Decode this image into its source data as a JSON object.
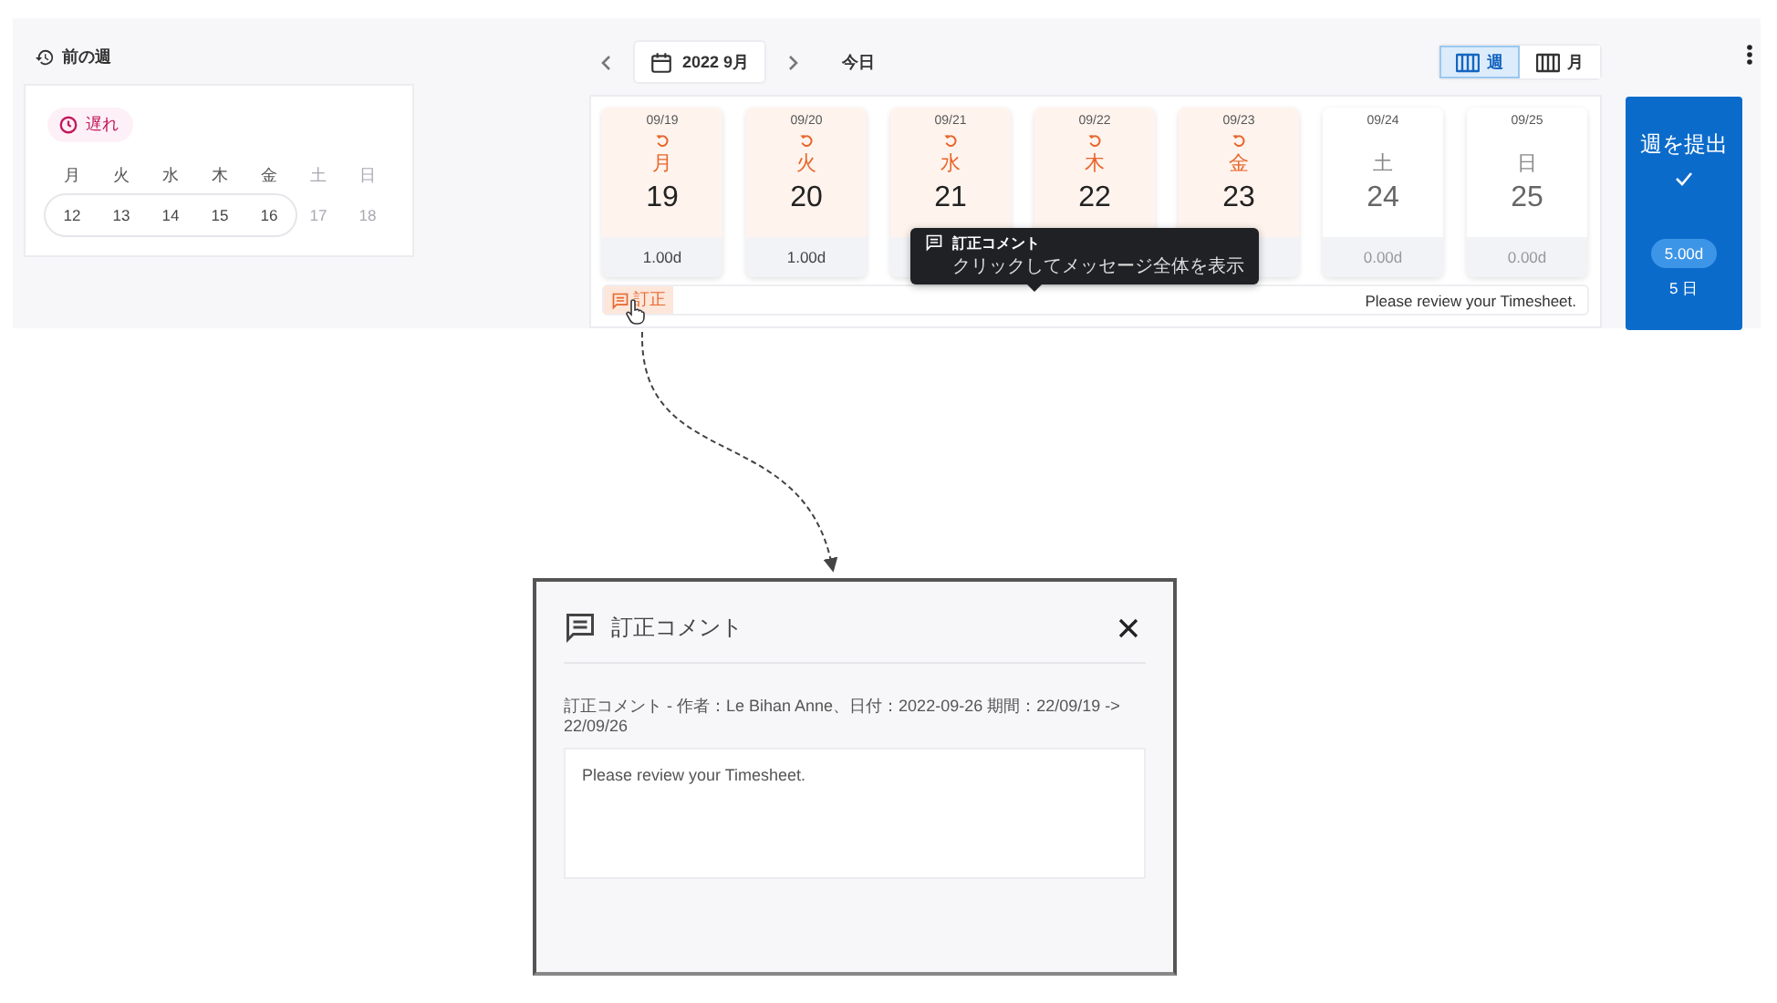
{
  "previous_week": {
    "button": "前の週",
    "status": "遅れ",
    "weekdays": [
      {
        "label": "月",
        "disabled": false
      },
      {
        "label": "火",
        "disabled": false
      },
      {
        "label": "水",
        "disabled": false
      },
      {
        "label": "木",
        "disabled": false
      },
      {
        "label": "金",
        "disabled": false
      },
      {
        "label": "土",
        "disabled": true
      },
      {
        "label": "日",
        "disabled": true
      }
    ],
    "dates": [
      {
        "label": "12",
        "disabled": false
      },
      {
        "label": "13",
        "disabled": false
      },
      {
        "label": "14",
        "disabled": false
      },
      {
        "label": "15",
        "disabled": false
      },
      {
        "label": "16",
        "disabled": false
      },
      {
        "label": "17",
        "disabled": true
      },
      {
        "label": "18",
        "disabled": true
      }
    ]
  },
  "header": {
    "month": "2022 9月",
    "today": "今日",
    "views": [
      {
        "label": "週",
        "selected": true
      },
      {
        "label": "月",
        "selected": false
      }
    ]
  },
  "days": [
    {
      "date": "09/19",
      "weekday": "月",
      "day": "19",
      "total": "1.00d",
      "corrected": true
    },
    {
      "date": "09/20",
      "weekday": "火",
      "day": "20",
      "total": "1.00d",
      "corrected": true
    },
    {
      "date": "09/21",
      "weekday": "水",
      "day": "21",
      "corrected": true
    },
    {
      "date": "09/22",
      "weekday": "木",
      "day": "22",
      "corrected": true
    },
    {
      "date": "09/23",
      "weekday": "金",
      "day": "23",
      "corrected": true
    },
    {
      "date": "09/24",
      "weekday": "土",
      "day": "24",
      "total": "0.00d",
      "corrected": false
    },
    {
      "date": "09/25",
      "weekday": "日",
      "day": "25",
      "total": "0.00d",
      "corrected": false
    }
  ],
  "comment_bar": {
    "tag": "訂正",
    "text": "Please review your Timesheet."
  },
  "tooltip": {
    "title": "訂正コメント",
    "text": "クリックしてメッセージ全体を表示"
  },
  "submit": {
    "label": "週を提出",
    "total": "5.00d",
    "days": "5 日"
  },
  "dialog": {
    "title": "訂正コメント",
    "meta": "訂正コメント - 作者：Le Bihan Anne、日付：2022-09-26 期間：22/09/19 -> 22/09/26",
    "comment": "Please review your Timesheet."
  }
}
